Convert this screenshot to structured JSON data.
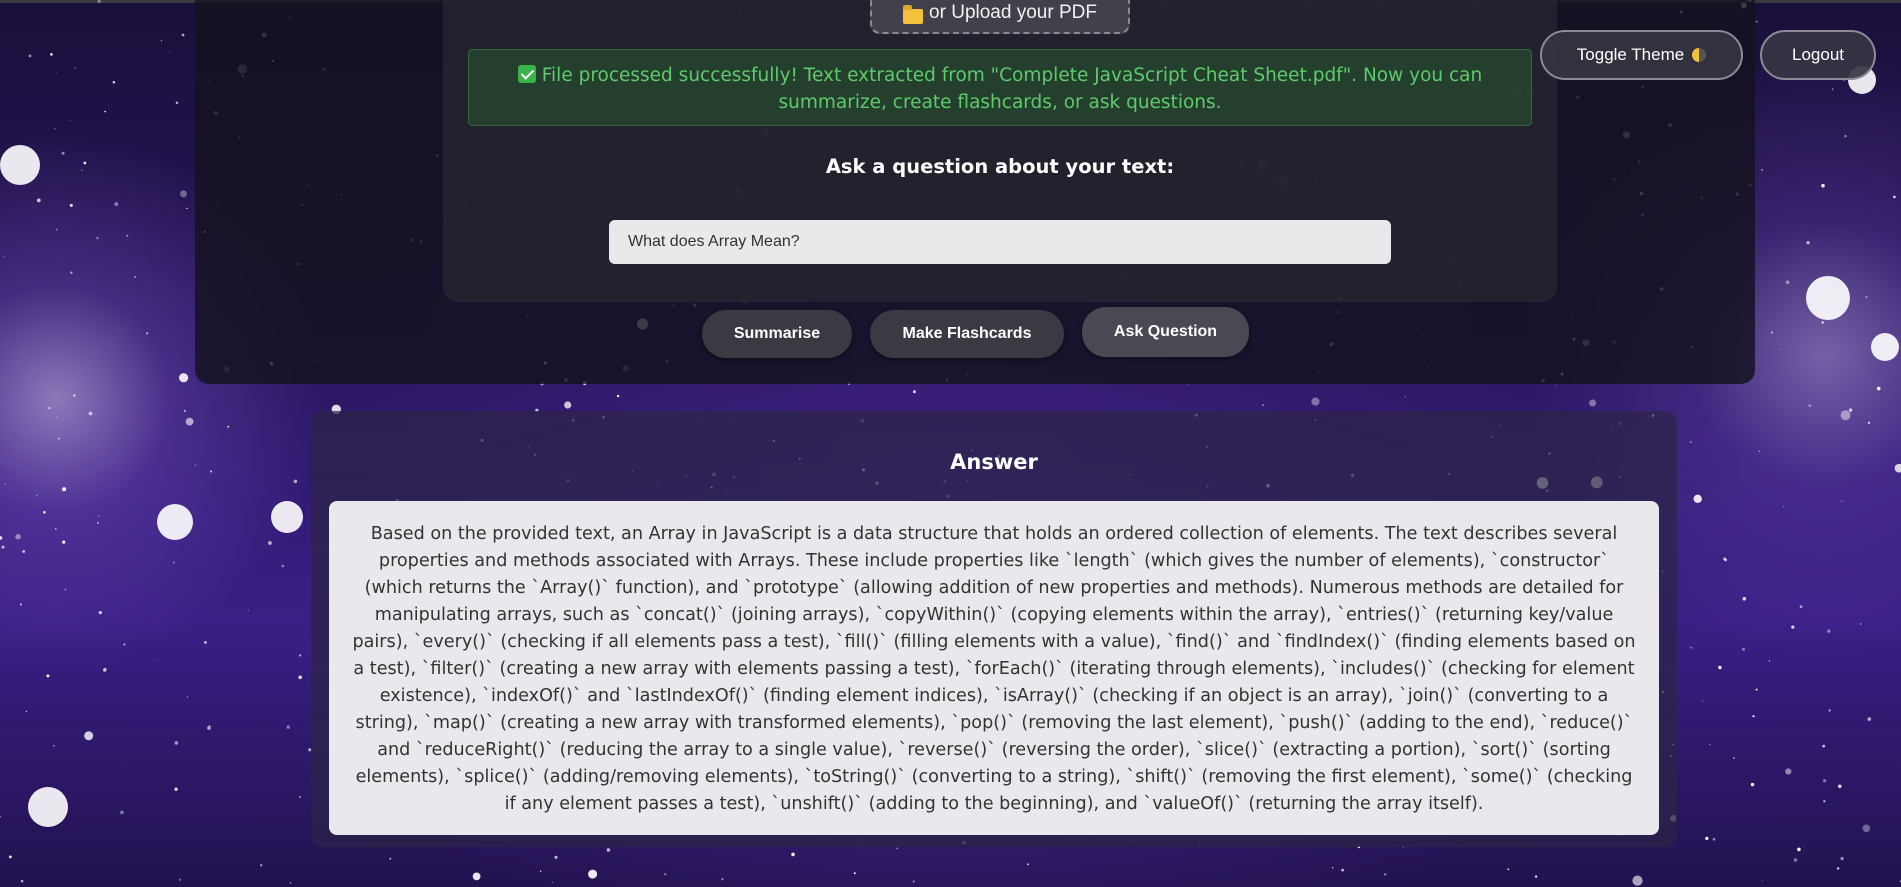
{
  "header": {
    "upload_label": "or Upload your PDF",
    "upload_icon": "folder-icon",
    "toggle_theme_label": "Toggle Theme",
    "toggle_theme_icon": "half-moon-icon",
    "logout_label": "Logout"
  },
  "status": {
    "icon": "check-icon",
    "message": "File processed successfully! Text extracted from \"Complete JavaScript Cheat Sheet.pdf\". Now you can summarize, create flashcards, or ask questions."
  },
  "question": {
    "heading": "Ask a question about your text:",
    "value": "What does Array Mean?"
  },
  "actions": {
    "summarise": "Summarise",
    "flashcards": "Make Flashcards",
    "ask": "Ask Question"
  },
  "answer": {
    "title": "Answer",
    "text": "Based on the provided text, an Array in JavaScript is a data structure that holds an ordered collection of elements.  The text describes several properties and methods associated with Arrays.  These include properties like `length` (which gives the number of elements), `constructor` (which returns the `Array()` function), and `prototype` (allowing addition of new properties and methods).  Numerous methods are detailed for manipulating arrays, such as `concat()` (joining arrays), `copyWithin()` (copying elements within the array), `entries()` (returning key/value pairs), `every()` (checking if all elements pass a test), `fill()` (filling elements with a value), `find()` and `findIndex()` (finding elements based on a test), `filter()` (creating a new array with elements passing a test), `forEach()` (iterating through elements),  `includes()` (checking for element existence), `indexOf()` and `lastIndexOf()` (finding element indices), `isArray()` (checking if an object is an array), `join()` (converting to a string), `map()` (creating a new array with transformed elements), `pop()` (removing the last element), `push()` (adding to the end), `reduce()` and `reduceRight()` (reducing the array to a single value), `reverse()` (reversing the order), `slice()` (extracting a portion), `sort()` (sorting elements), `splice()` (adding/removing elements), `toString()` (converting to a string), `shift()` (removing the first element), `some()` (checking if any element passes a test), `unshift()` (adding to the beginning), and `valueOf()` (returning the array itself)."
  },
  "colors": {
    "success_text": "#5ecb6a",
    "background_accent": "#3a1f86"
  }
}
